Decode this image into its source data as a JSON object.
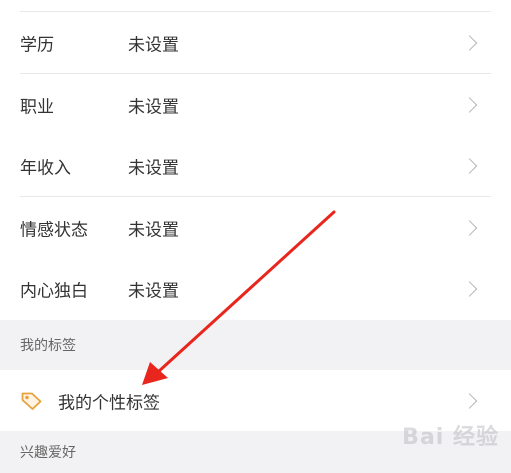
{
  "profile_fields": [
    {
      "label": "学历",
      "value": "未设置"
    },
    {
      "label": "职业",
      "value": "未设置"
    },
    {
      "label": "年收入",
      "value": "未设置"
    },
    {
      "label": "情感状态",
      "value": "未设置"
    },
    {
      "label": "内心独白",
      "value": "未设置"
    }
  ],
  "tags_section": {
    "title": "我的标签",
    "item_label": "我的个性标签",
    "icon": "tag-icon"
  },
  "interests_section": {
    "title": "兴趣爱好"
  },
  "watermark": "Bai 经验",
  "colors": {
    "arrow": "#e8261e",
    "tag_icon": "#e6a23c"
  }
}
